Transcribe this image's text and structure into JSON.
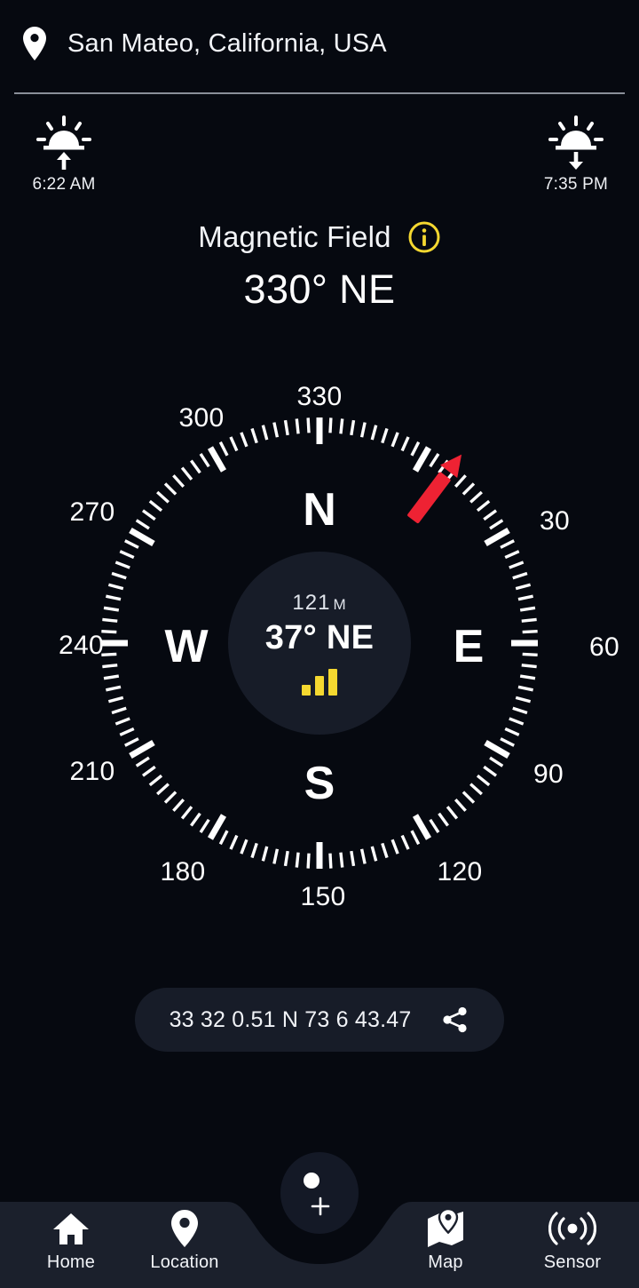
{
  "header": {
    "location_icon": "map-pin-icon",
    "location": "San Mateo, California, USA"
  },
  "sun": {
    "sunrise_icon": "sunrise-icon",
    "sunrise_time": "6:22 AM",
    "sunset_icon": "sunset-icon",
    "sunset_time": "7:35 PM"
  },
  "title": {
    "label": "Magnetic Field",
    "info_icon": "info-icon",
    "heading": "330° NE"
  },
  "compass": {
    "needle_color": "#ee2233",
    "needle_angle_deg": 37,
    "cardinals": [
      "N",
      "E",
      "S",
      "W"
    ],
    "degree_labels": [
      "330",
      "300",
      "270",
      "240",
      "210",
      "180",
      "150",
      "120",
      "90",
      "60",
      "30"
    ],
    "hub": {
      "field_value": "121",
      "field_unit": "Μ",
      "bearing": "37° NE",
      "signal_icon": "signal-bars-icon",
      "signal_color": "#f5d830",
      "signal_bars": 3
    }
  },
  "share": {
    "coordinates": "33 32 0.51 N 73 6 43.47",
    "share_icon": "share-icon"
  },
  "fab": {
    "icon": "add-location-icon"
  },
  "nav": {
    "items": [
      {
        "label": "Home",
        "icon": "home-icon"
      },
      {
        "label": "Location",
        "icon": "location-pin-icon"
      },
      {
        "label": "Map",
        "icon": "map-icon"
      },
      {
        "label": "Sensor",
        "icon": "sensor-waves-icon"
      }
    ]
  },
  "chart_data": {
    "type": "line",
    "title": "Magnetic Field Compass Dial",
    "categories": [
      "330",
      "300",
      "270",
      "240",
      "210",
      "180",
      "150",
      "120",
      "90",
      "60",
      "30"
    ],
    "values": [
      330,
      300,
      270,
      240,
      210,
      180,
      150,
      120,
      90,
      60,
      30
    ],
    "xlabel": "",
    "ylabel": "",
    "ylim": [
      0,
      360
    ],
    "annotations": [
      "N",
      "E",
      "S",
      "W",
      "37° NE",
      "121 Μ"
    ]
  }
}
